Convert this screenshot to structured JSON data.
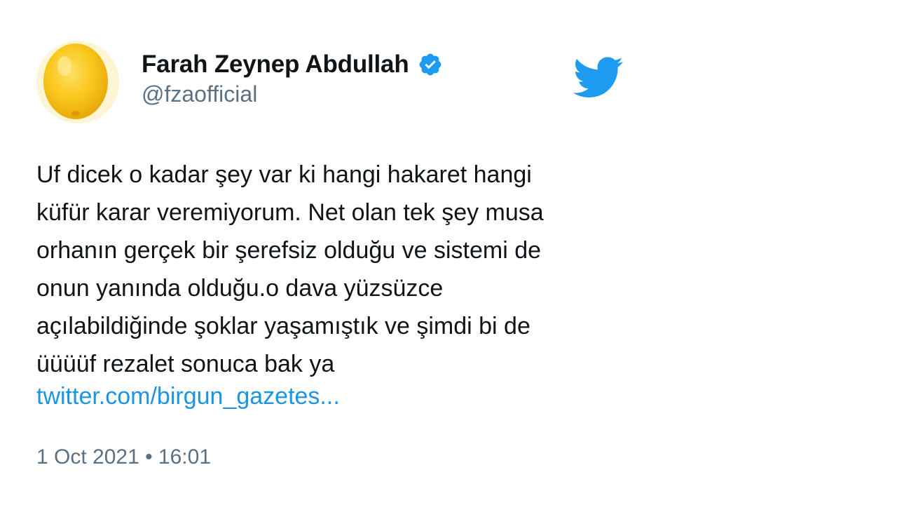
{
  "tweet": {
    "author": {
      "display_name": "Farah Zeynep Abdullah",
      "handle": "@fzaofficial",
      "verified": true,
      "verified_icon": "verified-badge-icon",
      "avatar_icon": "avatar-image"
    },
    "text": "Uf dicek o kadar şey var ki hangi hakaret hangi\nküfür karar veremiyorum. Net olan tek şey musa\norhanın gerçek bir şerefsiz olduğu ve sistemi de\nonun yanında olduğu.o dava yüzsüzce\naçılabildiğinde şoklar yaşamıştık ve şimdi bi de\nüüüüf rezalet sonuca bak ya",
    "link": "twitter.com/birgun_gazetes...",
    "timestamp": "1 Oct 2021 • 16:01"
  },
  "brand": {
    "logo_icon": "twitter-bird-icon"
  },
  "colors": {
    "brand_blue": "#1d9bf0",
    "link_blue": "#1b95e0",
    "text_primary": "#0f1419",
    "text_secondary": "#5b7083",
    "avatar_yellow": "#f7c51e"
  }
}
